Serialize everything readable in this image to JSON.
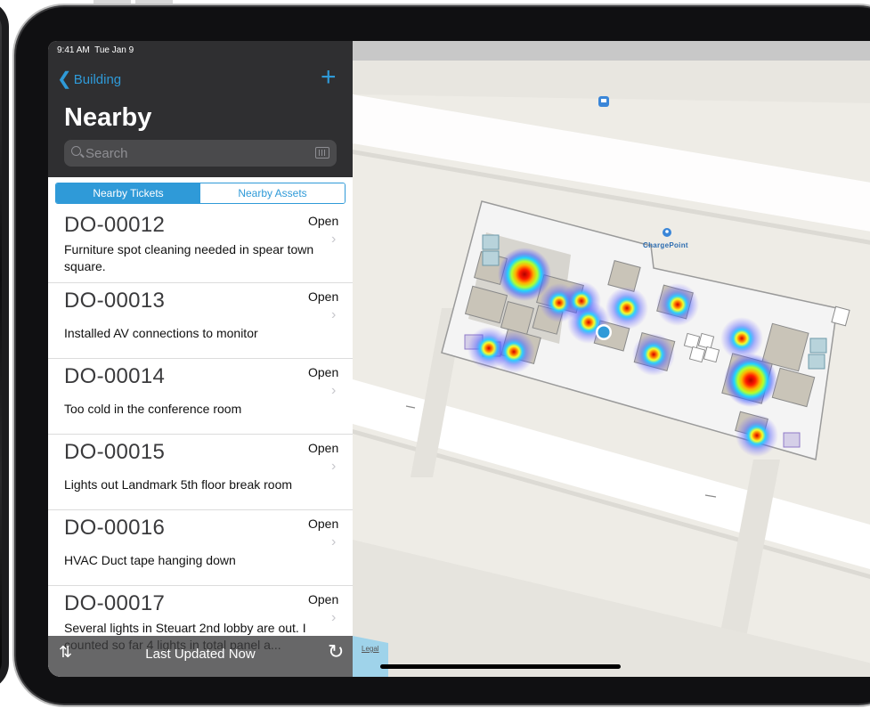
{
  "status_bar": {
    "time": "9:41 AM",
    "date": "Tue Jan 9"
  },
  "nav": {
    "back_label": "Building",
    "add_label": "+",
    "title": "Nearby"
  },
  "search": {
    "placeholder": "Search"
  },
  "segments": [
    {
      "label": "Nearby Tickets",
      "active": true
    },
    {
      "label": "Nearby Assets",
      "active": false
    }
  ],
  "tickets": [
    {
      "id": "DO-00012",
      "status": "Open",
      "description": "Furniture spot cleaning needed in spear town square."
    },
    {
      "id": "DO-00013",
      "status": "Open",
      "description": "Installed AV connections to monitor"
    },
    {
      "id": "DO-00014",
      "status": "Open",
      "description": "Too cold in the conference room"
    },
    {
      "id": "DO-00015",
      "status": "Open",
      "description": "Lights out Landmark 5th floor break room"
    },
    {
      "id": "DO-00016",
      "status": "Open",
      "description": "HVAC Duct tape hanging down"
    },
    {
      "id": "DO-00017",
      "status": "Open",
      "description": "Several lights in Steuart 2nd lobby are out. I counted so far 4 lights in total panel a..."
    }
  ],
  "bottom_bar": {
    "last_updated": "Last Updated Now"
  },
  "map": {
    "poi_label": "ChargePoint",
    "legal_label": "Legal",
    "colors": {
      "accent": "#2f9ad8",
      "user_location": "#2f9ad8"
    },
    "icons": [
      "bus-icon",
      "restroom-icon",
      "location-dot-icon",
      "pin-icon"
    ]
  },
  "colors": {
    "accent": "#2f9ad8",
    "panel_bg": "#2f2f31"
  }
}
